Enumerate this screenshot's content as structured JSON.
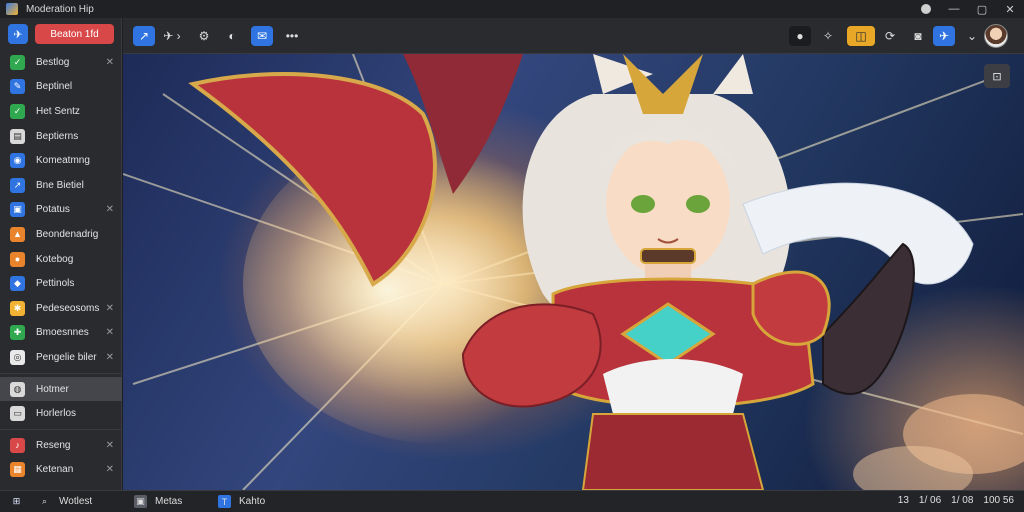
{
  "window": {
    "title": "Moderation Hip",
    "logo_icon": "app-logo-icon"
  },
  "window_controls": [
    {
      "name": "account-icon",
      "glyph": "●"
    },
    {
      "name": "minimize-icon",
      "glyph": "—"
    },
    {
      "name": "maximize-icon",
      "glyph": "▢"
    },
    {
      "name": "close-icon",
      "glyph": "✕"
    }
  ],
  "sidebar": {
    "home_icon": "bird-icon",
    "red_button_label": "Beaton 1fd",
    "items": [
      {
        "label": "Bestlog",
        "icon": "leaf-icon",
        "color": "#2fa84f",
        "glyph": "✓",
        "closable": true,
        "active": false
      },
      {
        "label": "Beptinel",
        "icon": "edit-icon",
        "color": "#2f74e0",
        "glyph": "✎",
        "closable": false,
        "active": false
      },
      {
        "label": "Het Sentz",
        "icon": "check-icon",
        "color": "#2fa84f",
        "glyph": "✓",
        "closable": false,
        "active": false
      },
      {
        "label": "Beptierns",
        "icon": "file-icon",
        "color": "#d9d9d9",
        "glyph": "▤",
        "closable": false,
        "active": false
      },
      {
        "label": "Komeatmng",
        "icon": "chat-icon",
        "color": "#2f74e0",
        "glyph": "◉",
        "closable": false,
        "active": false
      },
      {
        "label": "Bne Bietiel",
        "icon": "share-icon",
        "color": "#2f74e0",
        "glyph": "↗",
        "closable": false,
        "active": false
      },
      {
        "label": "Potatus",
        "icon": "book-icon",
        "color": "#2f74e0",
        "glyph": "▣",
        "closable": true,
        "active": false
      },
      {
        "label": "Beondenadrig",
        "icon": "flame-icon",
        "color": "#e9842c",
        "glyph": "▲",
        "closable": false,
        "active": false
      },
      {
        "label": "Kotebog",
        "icon": "coin-icon",
        "color": "#e9842c",
        "glyph": "●",
        "closable": false,
        "active": false
      },
      {
        "label": "Pettinols",
        "icon": "pin-icon",
        "color": "#2f74e0",
        "glyph": "◆",
        "closable": false,
        "active": false
      },
      {
        "label": "Pedeseosoms",
        "icon": "apps-icon",
        "color": "#f2b233",
        "glyph": "✱",
        "closable": true,
        "active": false
      },
      {
        "label": "Bmoesnnes",
        "icon": "puzzle-icon",
        "color": "#2fa84f",
        "glyph": "✚",
        "closable": true,
        "active": false
      },
      {
        "label": "Pengelie biler",
        "icon": "ring-icon",
        "color": "#e9e9e9",
        "glyph": "◎",
        "closable": true,
        "active": false
      },
      {
        "label": "Hotmer",
        "icon": "globe-icon",
        "color": "#d9d9d9",
        "glyph": "◍",
        "closable": false,
        "active": true
      },
      {
        "label": "Horlerlos",
        "icon": "window-icon",
        "color": "#d9d9d9",
        "glyph": "▭",
        "closable": false,
        "active": false
      },
      {
        "label": "Reseng",
        "icon": "music-icon",
        "color": "#d94848",
        "glyph": "♪",
        "closable": true,
        "active": false
      },
      {
        "label": "Ketenan",
        "icon": "shop-icon",
        "color": "#e9842c",
        "glyph": "▦",
        "closable": true,
        "active": false
      }
    ]
  },
  "toolbar": {
    "left": [
      {
        "name": "share-button",
        "icon": "share-icon",
        "glyph": "↗",
        "style": "blue"
      },
      {
        "name": "breadcrumb-button",
        "icon": "bird-icon",
        "glyph": "✈ ›",
        "style": "plain"
      },
      {
        "name": "settings-button",
        "icon": "gear-icon",
        "glyph": "⚙",
        "style": "plain"
      },
      {
        "name": "toggle-button",
        "icon": "toggle-icon",
        "glyph": "◐",
        "style": "plain"
      },
      {
        "name": "chat-button",
        "icon": "chat-icon",
        "glyph": "✉",
        "style": "blue"
      },
      {
        "name": "more-button",
        "icon": "more-icon",
        "glyph": "•••",
        "style": "plain"
      }
    ],
    "right": [
      {
        "name": "record-button",
        "icon": "record-icon",
        "glyph": "●",
        "style": "dark"
      },
      {
        "name": "wand-button",
        "icon": "wand-icon",
        "glyph": "✧",
        "style": "plain"
      },
      {
        "name": "highlight-button",
        "icon": "highlight-icon",
        "glyph": "◫",
        "style": "orange"
      },
      {
        "name": "sync-button",
        "icon": "sync-icon",
        "glyph": "⟳",
        "style": "plain"
      },
      {
        "name": "camera-button",
        "icon": "camera-icon",
        "glyph": "◙",
        "style": "plain"
      },
      {
        "name": "plane-button",
        "icon": "plane-icon",
        "glyph": "✈",
        "style": "blue"
      },
      {
        "name": "dropdown-button",
        "icon": "chevron-down-icon",
        "glyph": "⌄",
        "style": "plain"
      }
    ],
    "avatar": "user-avatar"
  },
  "content": {
    "corner_button_icon": "user-icon",
    "corner_button_glyph": "⊡"
  },
  "taskbar": {
    "start_icon": "windows-icon",
    "search_label": "Wotlest",
    "items": [
      {
        "label": "Metas",
        "icon": "app-icon"
      },
      {
        "label": "Kahto",
        "icon": "kahto-icon"
      }
    ],
    "tray": [
      "13",
      "1/ 06",
      "1/ 08",
      "100 56"
    ]
  }
}
